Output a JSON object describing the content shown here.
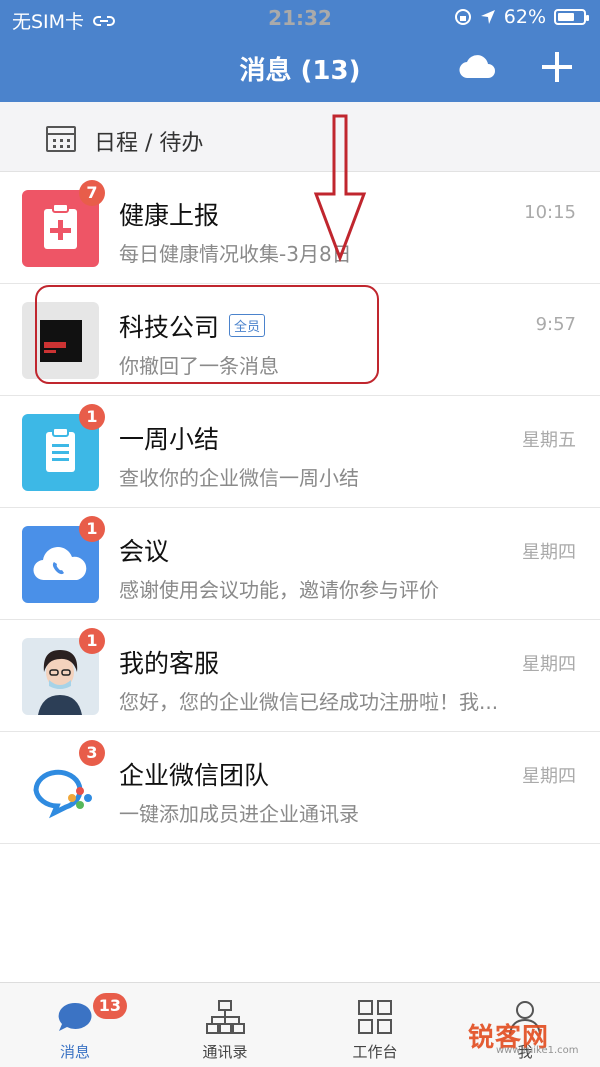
{
  "status_bar": {
    "carrier": "无SIM卡",
    "time": "21:32",
    "battery": "62%"
  },
  "header": {
    "title": "消息 (13)"
  },
  "schedule": {
    "label": "日程 / 待办"
  },
  "conversations": [
    {
      "title": "健康上报",
      "subtitle": "每日健康情况收集-3月8日",
      "time": "10:15",
      "badge": "7",
      "icon": "health-report-icon",
      "color": "#ee5566"
    },
    {
      "title": "科技公司",
      "tag": "全员",
      "subtitle": "你撤回了一条消息",
      "time": "9:57",
      "badge": "",
      "icon": "company-logo",
      "color": "#e6e6e6"
    },
    {
      "title": "一周小结",
      "subtitle": "查收你的企业微信一周小结",
      "time": "星期五",
      "badge": "1",
      "icon": "clipboard-icon",
      "color": "#3db8e6"
    },
    {
      "title": "会议",
      "subtitle": "感谢使用会议功能，邀请你参与评价",
      "time": "星期四",
      "badge": "1",
      "icon": "cloud-phone-icon",
      "color": "#4a90e8"
    },
    {
      "title": "我的客服",
      "subtitle": "您好，您的企业微信已经成功注册啦！我...",
      "time": "星期四",
      "badge": "1",
      "icon": "service-avatar",
      "color": "#dfe8ef"
    },
    {
      "title": "企业微信团队",
      "subtitle": "一键添加成员进企业通讯录",
      "time": "星期四",
      "badge": "3",
      "icon": "wecom-logo-icon",
      "color": "#ffffff"
    }
  ],
  "tabbar": {
    "tabs": [
      {
        "label": "消息",
        "badge": "13",
        "icon": "chat-bubble-icon"
      },
      {
        "label": "通讯录",
        "icon": "org-chart-icon"
      },
      {
        "label": "工作台",
        "icon": "grid-icon"
      },
      {
        "label": "我",
        "icon": "profile-icon"
      }
    ]
  },
  "watermark": {
    "brand": "锐客网",
    "site": "www.ruike1.com"
  },
  "colors": {
    "header": "#4b83cc",
    "badge": "#e85d4a",
    "highlight": "#c0262e"
  }
}
